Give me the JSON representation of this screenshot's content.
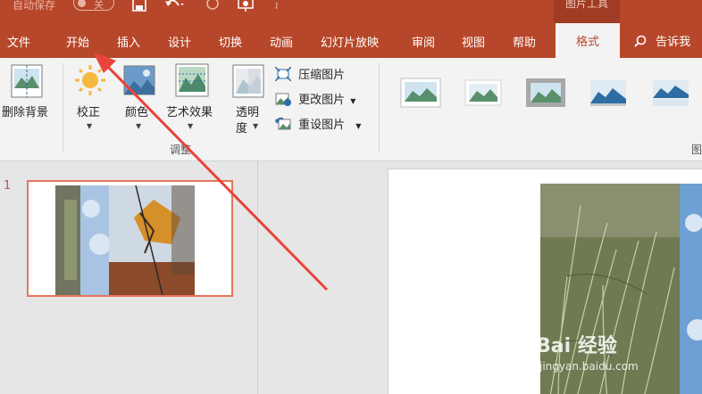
{
  "titlebar": {
    "autosave_label": "自动保存",
    "autosave_state": "关",
    "context_group": "图片工具",
    "icons": [
      "save-icon",
      "undo-icon",
      "redo-icon",
      "present-icon",
      "more-icon"
    ]
  },
  "tabs": [
    {
      "label": "文件"
    },
    {
      "label": "开始"
    },
    {
      "label": "插入"
    },
    {
      "label": "设计"
    },
    {
      "label": "切换"
    },
    {
      "label": "动画"
    },
    {
      "label": "幻灯片放映"
    },
    {
      "label": "审阅"
    },
    {
      "label": "视图"
    },
    {
      "label": "帮助"
    },
    {
      "label": "格式"
    }
  ],
  "active_tab": "格式",
  "tell_me": "告诉我",
  "ribbon": {
    "remove_bg": "删除背景",
    "corrections": "校正",
    "color": "颜色",
    "artistic": "艺术效果",
    "transparency": "透明",
    "transparency_line2": "度",
    "compress": "压缩图片",
    "change": "更改图片",
    "reset": "重设图片",
    "group_adjust": "调整",
    "group_styles": "图"
  },
  "slides": {
    "number": "1"
  },
  "watermark": {
    "brand": "Bai 经验",
    "url": "jingyan.baidu.com"
  },
  "colors": {
    "accent": "#b7472a",
    "selected_border": "#e5765a",
    "annotation_arrow": "#e8443a"
  }
}
